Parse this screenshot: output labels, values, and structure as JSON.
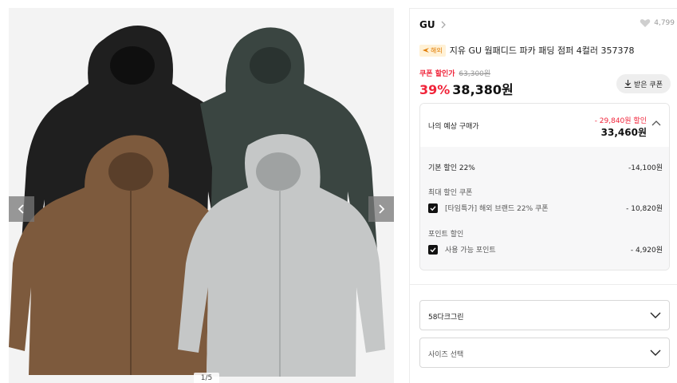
{
  "gallery": {
    "page_indicator": "1/5",
    "prev_icon": "chevron-left-icon",
    "next_icon": "chevron-right-icon",
    "jacket_colors": {
      "black": "#1f1f1f",
      "dark_green": "#3a4541",
      "brown": "#7d5a3d",
      "light_gray": "#c5c7c7"
    }
  },
  "product": {
    "brand": "GU",
    "like_count": "4,799",
    "tag": "해외",
    "title": "지유 GU 웜패디드 파카 패딩 점퍼 4컬러 357378",
    "coupon_label": "쿠폰 할인가",
    "original_price": "63,300원",
    "discount_rate": "39%",
    "price": "38,380원",
    "coupon_button": "받은 쿠폰"
  },
  "expected": {
    "label": "나의 예상 구매가",
    "saving": "- 29,840원 할인",
    "price": "33,460원",
    "base_discount_label": "기본 할인 22%",
    "base_discount_amount": "-14,100원",
    "coupon_section": "최대 할인 쿠폰",
    "coupon_item": "[타임특가] 해외 브랜드 22% 쿠폰",
    "coupon_amount": "- 10,820원",
    "point_section": "포인트 할인",
    "point_item": "사용 가능 포인트",
    "point_amount": "- 4,920원"
  },
  "options": {
    "color_selected": "58다크그린",
    "size_placeholder": "사이즈 선택"
  },
  "colors": {
    "accent_red": "#f0243a",
    "tag_orange": "#e07b00"
  }
}
